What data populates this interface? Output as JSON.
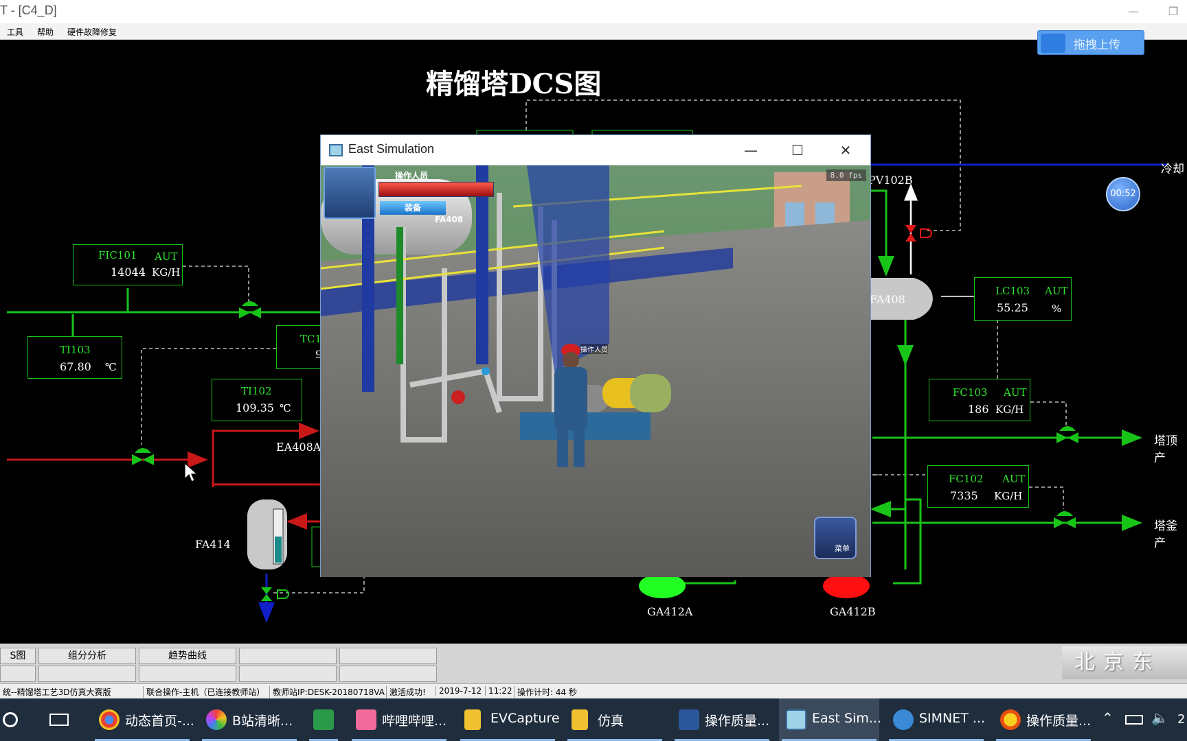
{
  "window": {
    "title": "T - [C4_D]",
    "minimize": "—",
    "restore": "❐"
  },
  "menu": [
    "工具",
    "帮助",
    "硬件故障修复"
  ],
  "upload_button": "拖拽上传",
  "timer": "00:52",
  "dcs": {
    "title": "精馏塔DCS图",
    "controllers": {
      "FIC101": {
        "tag": "FIC101",
        "mode": "AUT",
        "value": "14044",
        "unit": "KG/H"
      },
      "TI103": {
        "tag": "TI103",
        "value": "67.80",
        "unit": "℃"
      },
      "TC": {
        "tag": "TC1(",
        "value": "9"
      },
      "TI102": {
        "tag": "TI102",
        "value": "109.35",
        "unit": "℃"
      },
      "LC103": {
        "tag": "LC103",
        "mode": "AUT",
        "value": "55.25",
        "unit": "%"
      },
      "FC103": {
        "tag": "FC103",
        "mode": "AUT",
        "value": "186",
        "unit": "KG/H"
      },
      "FC102": {
        "tag": "FC102",
        "mode": "AUT",
        "value": "7335",
        "unit": "KG/H"
      }
    },
    "labels": {
      "EA408A": "EA408A",
      "FA414": "FA414",
      "FA408": "FA408",
      "PV102B": "PV102B",
      "GA412A": "GA412A",
      "GA412B": "GA412B",
      "cooling": "冷却",
      "tower_top": "塔顶产",
      "tower_bottom": "塔釜产"
    },
    "colors": {
      "green": "#19c419",
      "red": "#c81818",
      "blue": "#1020c8",
      "white_dash": "#e0e0e0"
    }
  },
  "sim_window": {
    "title": "East Simulation",
    "fps": "8.0 fps",
    "operator_label": "操作人员",
    "equip_label": "装备",
    "scene_tag": "FA408",
    "person_tag": "操作人员",
    "menu_label": "菜单"
  },
  "bottom_nav": {
    "row1": [
      "S图",
      "组分分析",
      "趋势曲线",
      "",
      ""
    ],
    "brand": "北京东方"
  },
  "status": {
    "s1": "统--精馏塔工艺3D仿真大赛版",
    "s2": "联合操作-主机（已连接教师站）",
    "s3": "教师站IP:DESK-20180718VA",
    "s4": "激活成功!",
    "s5": "2019-7-12",
    "s6": "11:22",
    "s7": "操作计时: 44 秒"
  },
  "taskbar": {
    "items": [
      "动态首页-...",
      "B站清晰...",
      "",
      "哔哩哔哩...",
      "EVCapture",
      "仿真",
      "操作质量...",
      "East Sim...",
      "SIMNET ...",
      "操作质量..."
    ],
    "clock": "2"
  }
}
